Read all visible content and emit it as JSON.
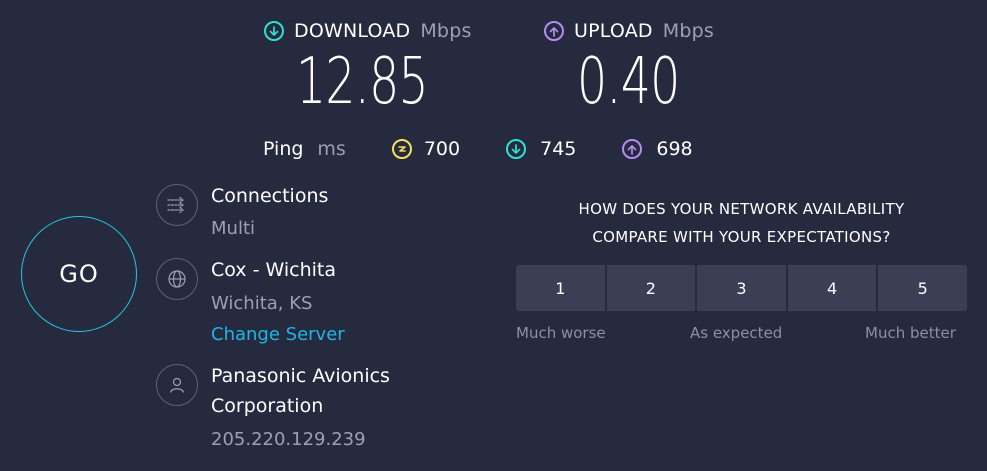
{
  "download": {
    "label": "DOWNLOAD",
    "unit": "Mbps",
    "value": "12.85",
    "icon": "download-arrow-icon",
    "color": "#2ee0d0"
  },
  "upload": {
    "label": "UPLOAD",
    "unit": "Mbps",
    "value": "0.40",
    "icon": "upload-arrow-icon",
    "color": "#b48cf2"
  },
  "ping": {
    "label": "Ping",
    "unit": "ms",
    "idle": {
      "value": "700",
      "icon": "ping-icon",
      "color": "#f6e05e"
    },
    "download": {
      "value": "745",
      "icon": "download-arrow-icon",
      "color": "#2ee0d0"
    },
    "upload": {
      "value": "698",
      "icon": "upload-arrow-icon",
      "color": "#b48cf2"
    }
  },
  "go_button": {
    "label": "GO"
  },
  "connections": {
    "title": "Connections",
    "value": "Multi",
    "icon": "connections-icon"
  },
  "server": {
    "title": "Cox - Wichita",
    "location": "Wichita, KS",
    "change_link": "Change Server",
    "icon": "globe-icon"
  },
  "provider": {
    "name_line1": "Panasonic Avionics",
    "name_line2": "Corporation",
    "ip": "205.220.129.239",
    "icon": "user-icon"
  },
  "survey": {
    "question_line1": "HOW DOES YOUR NETWORK AVAILABILITY",
    "question_line2": "COMPARE WITH YOUR EXPECTATIONS?",
    "options": [
      "1",
      "2",
      "3",
      "4",
      "5"
    ],
    "label_low": "Much worse",
    "label_mid": "As expected",
    "label_high": "Much better"
  },
  "colors": {
    "background": "#262a3e",
    "accent": "#1fb5e6"
  }
}
